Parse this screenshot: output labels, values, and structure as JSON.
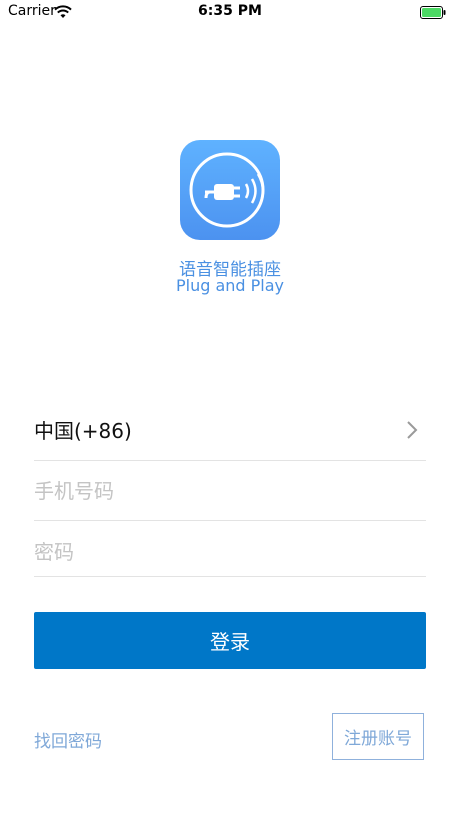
{
  "status_bar": {
    "carrier": "Carrier",
    "time": "6:35 PM",
    "battery_color": "#4cd964"
  },
  "logo": {
    "icon": "plug-sound-icon",
    "gradient_top": "#5fb2ff",
    "gradient_bottom": "#4c92f0",
    "title_cn": "语音智能插座",
    "title_en": "Plug and Play"
  },
  "form": {
    "country": "中国(+86)",
    "phone_placeholder": "手机号码",
    "phone_value": "",
    "password_placeholder": "密码",
    "password_value": ""
  },
  "actions": {
    "login_label": "登录",
    "forgot_label": "找回密码",
    "register_label": "注册账号",
    "accent_color": "#0077c8"
  }
}
